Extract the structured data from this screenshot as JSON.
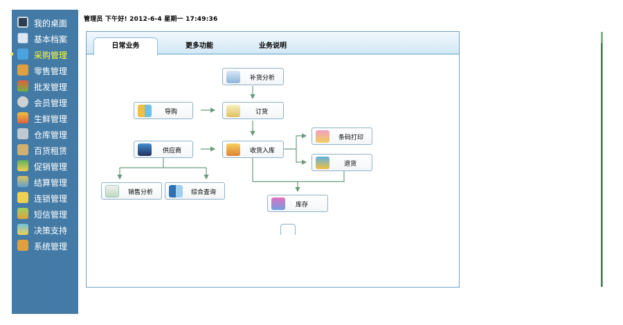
{
  "sidebar": {
    "items": [
      {
        "label": "我的桌面",
        "icon": "monitor-icon",
        "color": "#2c3e50"
      },
      {
        "label": "基本档案",
        "icon": "document-user-icon",
        "color": "#6c9ad0"
      },
      {
        "label": "采购管理",
        "icon": "cart-icon",
        "color": "#4aa3df"
      },
      {
        "label": "零售管理",
        "icon": "store-icon",
        "color": "#e0a040"
      },
      {
        "label": "批发管理",
        "icon": "truck-icon",
        "color": "#e06040"
      },
      {
        "label": "会员管理",
        "icon": "members-icon",
        "color": "#d0d0d0"
      },
      {
        "label": "生鲜管理",
        "icon": "fresh-icon",
        "color": "#f0c040"
      },
      {
        "label": "仓库管理",
        "icon": "warehouse-icon",
        "color": "#c0c8d0"
      },
      {
        "label": "百货租赁",
        "icon": "lease-icon",
        "color": "#d0b070"
      },
      {
        "label": "促销管理",
        "icon": "promo-icon",
        "color": "#60b060"
      },
      {
        "label": "结算管理",
        "icon": "settle-icon",
        "color": "#e0c060"
      },
      {
        "label": "连锁管理",
        "icon": "chain-icon",
        "color": "#f0d050"
      },
      {
        "label": "短信管理",
        "icon": "sms-icon",
        "color": "#a0d060"
      },
      {
        "label": "决策支持",
        "icon": "decision-icon",
        "color": "#70c0e0"
      },
      {
        "label": "系统管理",
        "icon": "system-icon",
        "color": "#e0a040"
      }
    ],
    "active_index": 2,
    "background": "#447ba6",
    "active_text_color": "#ffff33"
  },
  "header": {
    "greeting": "管理员 下午好! 2012-6-4 星期一 17:49:36"
  },
  "tabs": [
    {
      "label": "日常业务",
      "active": true
    },
    {
      "label": "更多功能",
      "active": false
    },
    {
      "label": "业务说明",
      "active": false
    }
  ],
  "flow": {
    "nodes": [
      {
        "id": "replenish",
        "label": "补货分析",
        "icon": "analysis-icon"
      },
      {
        "id": "guide",
        "label": "导购",
        "icon": "guide-icon"
      },
      {
        "id": "order",
        "label": "订货",
        "icon": "order-icon"
      },
      {
        "id": "supplier",
        "label": "供应商",
        "icon": "supplier-icon"
      },
      {
        "id": "receive",
        "label": "收货入库",
        "icon": "receive-icon"
      },
      {
        "id": "barcode",
        "label": "条码打印",
        "icon": "barcode-icon"
      },
      {
        "id": "return",
        "label": "退货",
        "icon": "return-icon"
      },
      {
        "id": "sales_analysis",
        "label": "销售分析",
        "icon": "sales-analysis-icon"
      },
      {
        "id": "query",
        "label": "综合查询",
        "icon": "query-icon"
      },
      {
        "id": "stock",
        "label": "库存",
        "icon": "stock-icon"
      }
    ],
    "line_color": "#6a9a7c"
  }
}
